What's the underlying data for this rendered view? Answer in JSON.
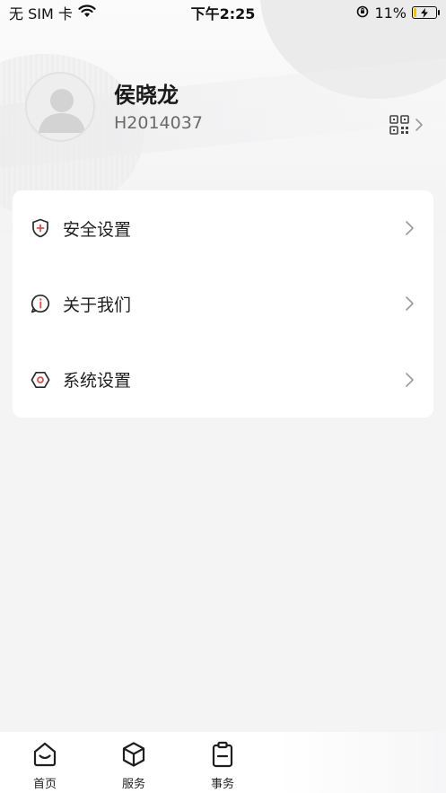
{
  "status_bar": {
    "carrier": "无 SIM 卡",
    "time": "下午2:25",
    "battery_percent": "11%",
    "battery_level": 0.11
  },
  "profile": {
    "name": "侯晓龙",
    "employee_id": "H2014037"
  },
  "menu": {
    "items": [
      {
        "label": "安全设置",
        "icon": "shield-plus-icon"
      },
      {
        "label": "关于我们",
        "icon": "info-bubble-icon"
      },
      {
        "label": "系统设置",
        "icon": "hexagon-gear-icon"
      }
    ]
  },
  "tab_bar": {
    "tabs": [
      {
        "label": "首页",
        "icon": "home-icon"
      },
      {
        "label": "服务",
        "icon": "cube-icon"
      },
      {
        "label": "事务",
        "icon": "clipboard-icon"
      }
    ]
  },
  "colors": {
    "accent_red": "#d9534f",
    "background": "#f4f4f5",
    "card": "#ffffff"
  }
}
